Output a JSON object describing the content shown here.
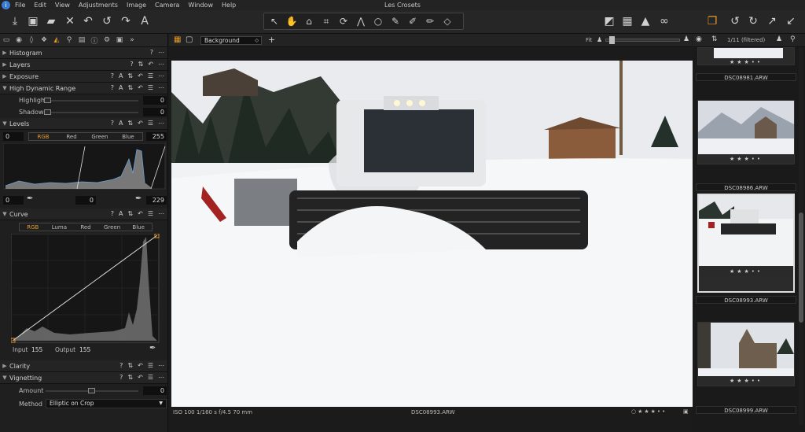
{
  "app": {
    "window_title": "Les Crosets"
  },
  "menu": [
    "File",
    "Edit",
    "View",
    "Adjustments",
    "Image",
    "Camera",
    "Window",
    "Help"
  ],
  "colors": {
    "accent": "#e89a2a",
    "bg": "#1b1b1b"
  },
  "toolbar": {
    "left_icons": [
      "import-icon",
      "camera-icon",
      "folder-icon",
      "delete-icon",
      "undo-icon",
      "undo-step-icon",
      "redo-icon",
      "text-icon"
    ],
    "cursor_tools": [
      "select-icon",
      "pan-icon",
      "crop-icon",
      "straighten-icon",
      "rotate-icon",
      "keystone-icon",
      "circle-icon",
      "brush-icon",
      "eraser-icon",
      "fill-icon",
      "picker-icon"
    ],
    "right_icons": [
      "exposure-warning-icon",
      "grid-icon",
      "alert-icon",
      "glasses-icon",
      "stack-icon",
      "rotate-left-icon",
      "rotate-right-icon",
      "export-icon",
      "import-arrow-icon"
    ]
  },
  "layer_select": "Background",
  "sections": {
    "histogram": "Histogram",
    "layers": "Layers",
    "exposure": "Exposure",
    "hdr": "High Dynamic Range",
    "highlight_label": "Highlight",
    "highlight_value": "0",
    "shadow_label": "Shadow",
    "shadow_value": "0",
    "levels": "Levels",
    "levels_left": "0",
    "levels_right": "255",
    "levels_tabs": [
      "RGB",
      "Red",
      "Green",
      "Blue"
    ],
    "levels_out_left": "0",
    "levels_out_mid": "0",
    "levels_out_right": "229",
    "curve": "Curve",
    "curve_tabs": [
      "RGB",
      "Luma",
      "Red",
      "Green",
      "Blue"
    ],
    "input_label": "Input",
    "input_value": "155",
    "output_label": "Output",
    "output_value": "155",
    "clarity": "Clarity",
    "vignetting": "Vignetting",
    "amount_label": "Amount",
    "amount_value": "0",
    "method_label": "Method",
    "method_value": "Elliptic on Crop"
  },
  "viewbar": {
    "fit": "Fit"
  },
  "status": {
    "exif": "ISO 100  1/160 s  f/4.5  70 mm",
    "filename": "DSC08993.ARW"
  },
  "browser": {
    "count": "1/11 (filtered)",
    "items": [
      {
        "name": "DSC08981.ARW"
      },
      {
        "name": "DSC08986.ARW"
      },
      {
        "name": "DSC08993.ARW"
      },
      {
        "name": "DSC08999.ARW"
      }
    ]
  }
}
